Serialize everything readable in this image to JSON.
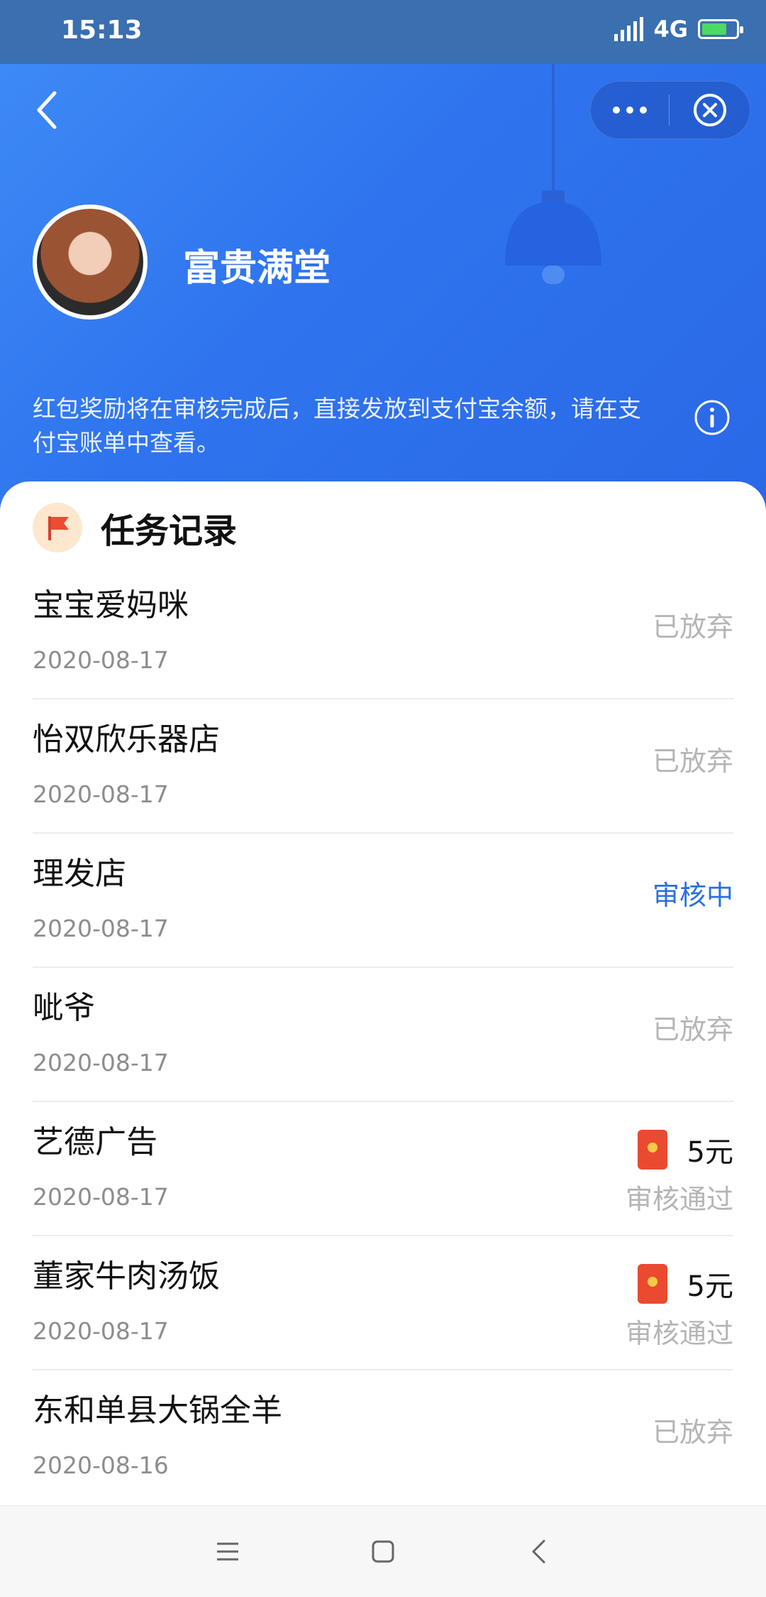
{
  "status_bar": {
    "time": "15:13",
    "network": "4G"
  },
  "header": {
    "user_name": "富贵满堂",
    "notice": "红包奖励将在审核完成后，直接发放到支付宝余额，请在支付宝账单中查看。",
    "icons": [
      "back-arrow-icon",
      "more-dots-icon",
      "close-circle-icon",
      "info-icon",
      "lamp-illustration"
    ]
  },
  "records": {
    "title": "任务记录",
    "icon": "red-flag-icon",
    "items": [
      {
        "name": "宝宝爱妈咪",
        "date": "2020-08-17",
        "status": "已放弃"
      },
      {
        "name": "怡双欣乐器店",
        "date": "2020-08-17",
        "status": "已放弃"
      },
      {
        "name": "理发店",
        "date": "2020-08-17",
        "status": "审核中"
      },
      {
        "name": "呲爷",
        "date": "2020-08-17",
        "status": "已放弃"
      },
      {
        "name": "艺德广告",
        "date": "2020-08-17",
        "amount": "5元",
        "status": "审核通过"
      },
      {
        "name": "董家牛肉汤饭",
        "date": "2020-08-17",
        "amount": "5元",
        "status": "审核通过"
      },
      {
        "name": "东和单县大锅全羊",
        "date": "2020-08-16",
        "status": "已放弃"
      }
    ]
  },
  "colors": {
    "header_blue": "#2f74ee",
    "reviewing_blue": "#2b6fe0",
    "status_gray": "#b5b5b5",
    "redpacket_red": "#ea4a2f"
  }
}
